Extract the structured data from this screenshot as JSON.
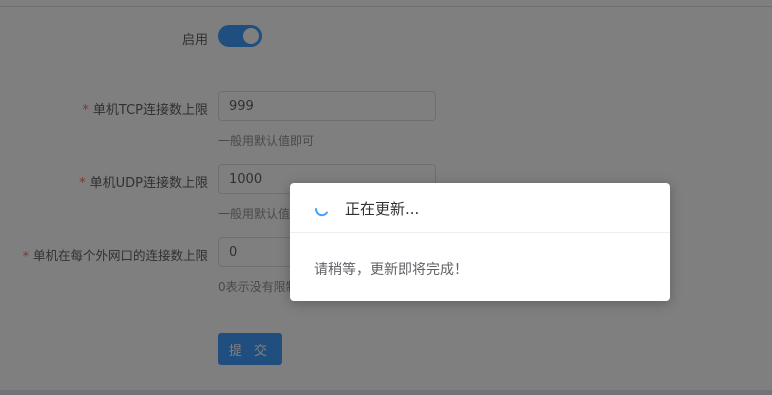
{
  "form": {
    "enable": {
      "label": "启用",
      "on": true
    },
    "tcp_limit": {
      "required": "*",
      "label": "单机TCP连接数上限",
      "value": "999",
      "hint": "一般用默认值即可"
    },
    "udp_limit": {
      "required": "*",
      "label": "单机UDP连接数上限",
      "value": "1000",
      "hint": "一般用默认值即可"
    },
    "per_ip_limit": {
      "required": "*",
      "label": "单机在每个外网口的连接数上限",
      "value": "0",
      "hint": "0表示没有限制"
    },
    "submit_label": "提 交"
  },
  "dialog": {
    "title": "正在更新...",
    "message": "请稍等，更新即将完成！"
  },
  "colors": {
    "primary": "#409eff",
    "required": "#f56c6c"
  }
}
